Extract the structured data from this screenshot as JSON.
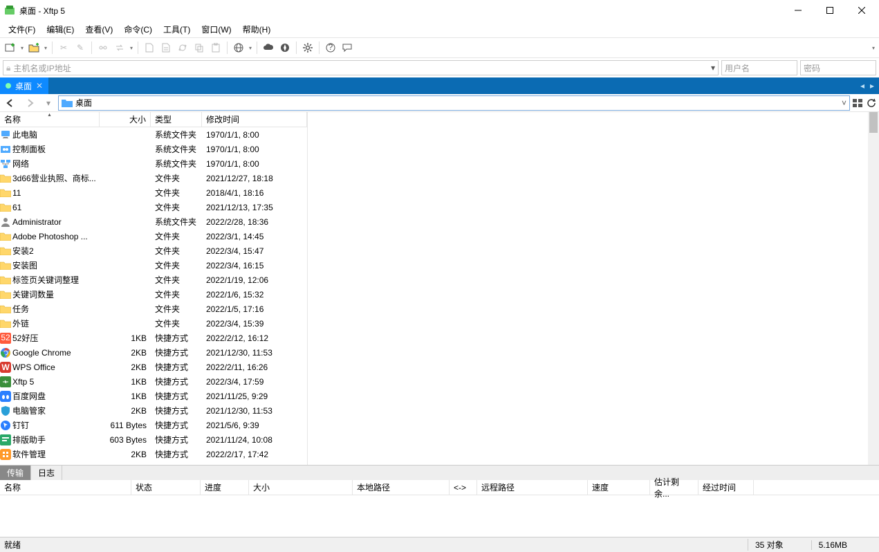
{
  "window": {
    "title": "桌面 - Xftp 5"
  },
  "menu": {
    "file": "文件(F)",
    "edit": "编辑(E)",
    "view": "查看(V)",
    "command": "命令(C)",
    "tools": "工具(T)",
    "window": "窗口(W)",
    "help": "帮助(H)"
  },
  "addressbar": {
    "placeholder": "主机名或IP地址",
    "user_placeholder": "用户名",
    "pass_placeholder": "密码"
  },
  "tab": {
    "label": "桌面"
  },
  "pathbar": {
    "current": "桌面"
  },
  "columns": {
    "name": "名称",
    "size": "大小",
    "type": "类型",
    "mtime": "修改时间"
  },
  "files": [
    {
      "icon": "pc",
      "name": "此电脑",
      "size": "",
      "type": "系统文件夹",
      "mtime": "1970/1/1, 8:00"
    },
    {
      "icon": "panel",
      "name": "控制面板",
      "size": "",
      "type": "系统文件夹",
      "mtime": "1970/1/1, 8:00"
    },
    {
      "icon": "network",
      "name": "网络",
      "size": "",
      "type": "系统文件夹",
      "mtime": "1970/1/1, 8:00"
    },
    {
      "icon": "folder",
      "name": "3d66营业执照、商标...",
      "size": "",
      "type": "文件夹",
      "mtime": "2021/12/27, 18:18"
    },
    {
      "icon": "folder",
      "name": "11",
      "size": "",
      "type": "文件夹",
      "mtime": "2018/4/1, 18:16"
    },
    {
      "icon": "folder",
      "name": "61",
      "size": "",
      "type": "文件夹",
      "mtime": "2021/12/13, 17:35"
    },
    {
      "icon": "user",
      "name": "Administrator",
      "size": "",
      "type": "系统文件夹",
      "mtime": "2022/2/28, 18:36"
    },
    {
      "icon": "folder",
      "name": "Adobe Photoshop ...",
      "size": "",
      "type": "文件夹",
      "mtime": "2022/3/1, 14:45"
    },
    {
      "icon": "folder",
      "name": "安装2",
      "size": "",
      "type": "文件夹",
      "mtime": "2022/3/4, 15:47"
    },
    {
      "icon": "folder",
      "name": "安装图",
      "size": "",
      "type": "文件夹",
      "mtime": "2022/3/4, 16:15"
    },
    {
      "icon": "folder",
      "name": "标签页关键词整理",
      "size": "",
      "type": "文件夹",
      "mtime": "2022/1/19, 12:06"
    },
    {
      "icon": "folder",
      "name": "关键词数量",
      "size": "",
      "type": "文件夹",
      "mtime": "2022/1/6, 15:32"
    },
    {
      "icon": "folder",
      "name": "任务",
      "size": "",
      "type": "文件夹",
      "mtime": "2022/1/5, 17:16"
    },
    {
      "icon": "folder",
      "name": "外链",
      "size": "",
      "type": "文件夹",
      "mtime": "2022/3/4, 15:39"
    },
    {
      "icon": "app-52",
      "name": "52好压",
      "size": "1KB",
      "type": "快捷方式",
      "mtime": "2022/2/12, 16:12"
    },
    {
      "icon": "chrome",
      "name": "Google Chrome",
      "size": "2KB",
      "type": "快捷方式",
      "mtime": "2021/12/30, 11:53"
    },
    {
      "icon": "wps",
      "name": "WPS Office",
      "size": "2KB",
      "type": "快捷方式",
      "mtime": "2022/2/11, 16:26"
    },
    {
      "icon": "xftp",
      "name": "Xftp 5",
      "size": "1KB",
      "type": "快捷方式",
      "mtime": "2022/3/4, 17:59"
    },
    {
      "icon": "baidu",
      "name": "百度网盘",
      "size": "1KB",
      "type": "快捷方式",
      "mtime": "2021/11/25, 9:29"
    },
    {
      "icon": "guard",
      "name": "电脑管家",
      "size": "2KB",
      "type": "快捷方式",
      "mtime": "2021/12/30, 11:53"
    },
    {
      "icon": "ding",
      "name": "钉钉",
      "size": "611 Bytes",
      "type": "快捷方式",
      "mtime": "2021/5/6, 9:39"
    },
    {
      "icon": "pai",
      "name": "排版助手",
      "size": "603 Bytes",
      "type": "快捷方式",
      "mtime": "2021/11/24, 10:08"
    },
    {
      "icon": "soft",
      "name": "软件管理",
      "size": "2KB",
      "type": "快捷方式",
      "mtime": "2022/2/17, 17:42"
    }
  ],
  "bottom_tabs": {
    "transfer": "传输",
    "log": "日志"
  },
  "transfer_columns": {
    "name": "名称",
    "status": "状态",
    "progress": "进度",
    "size": "大小",
    "local": "本地路径",
    "arrow": "<->",
    "remote": "远程路径",
    "speed": "速度",
    "remain": "估计剩余...",
    "elapsed": "经过时间"
  },
  "status": {
    "ready": "就绪",
    "objects": "35 对象",
    "total": "5.16MB"
  }
}
